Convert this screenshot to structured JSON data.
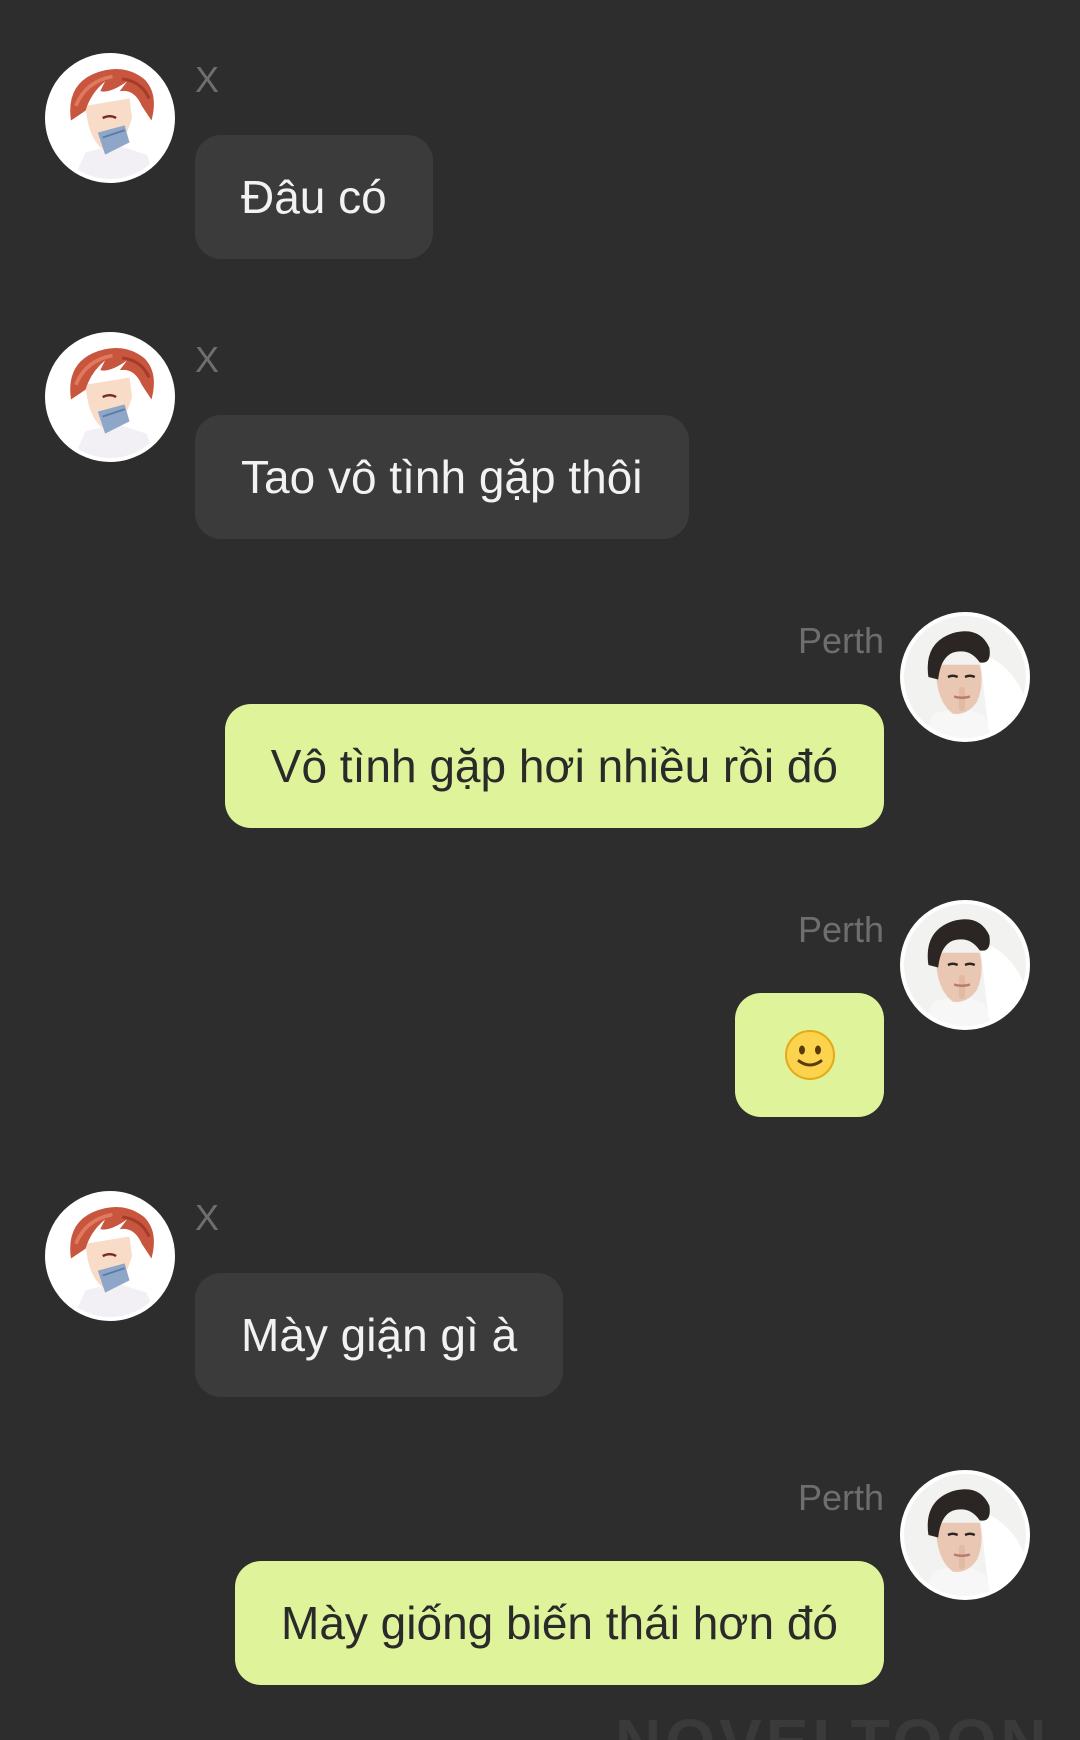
{
  "conversation": {
    "messages": [
      {
        "sender": "X",
        "text": "Đâu có",
        "side": "left"
      },
      {
        "sender": "X",
        "text": "Tao vô tình gặp thôi",
        "side": "left"
      },
      {
        "sender": "Perth",
        "text": "Vô tình gặp hơi nhiều rồi đó",
        "side": "right"
      },
      {
        "sender": "Perth",
        "emoji": "slightly-smiling-face",
        "side": "right"
      },
      {
        "sender": "X",
        "text": "Mày giận gì à",
        "side": "left"
      },
      {
        "sender": "Perth",
        "text": "Mày giống biến thái hơn đó",
        "side": "right"
      }
    ]
  },
  "avatars": {
    "x": {
      "icon": "red-haired-anime-boy-avatar"
    },
    "perth": {
      "icon": "dark-haired-boy-photo-avatar"
    }
  },
  "colors": {
    "background": "#2d2d2d",
    "incoming_bubble": "#3b3b3b",
    "outgoing_bubble": "#dff39a",
    "sender_name": "#6e6e6e"
  },
  "watermark": "NOVELTOON"
}
